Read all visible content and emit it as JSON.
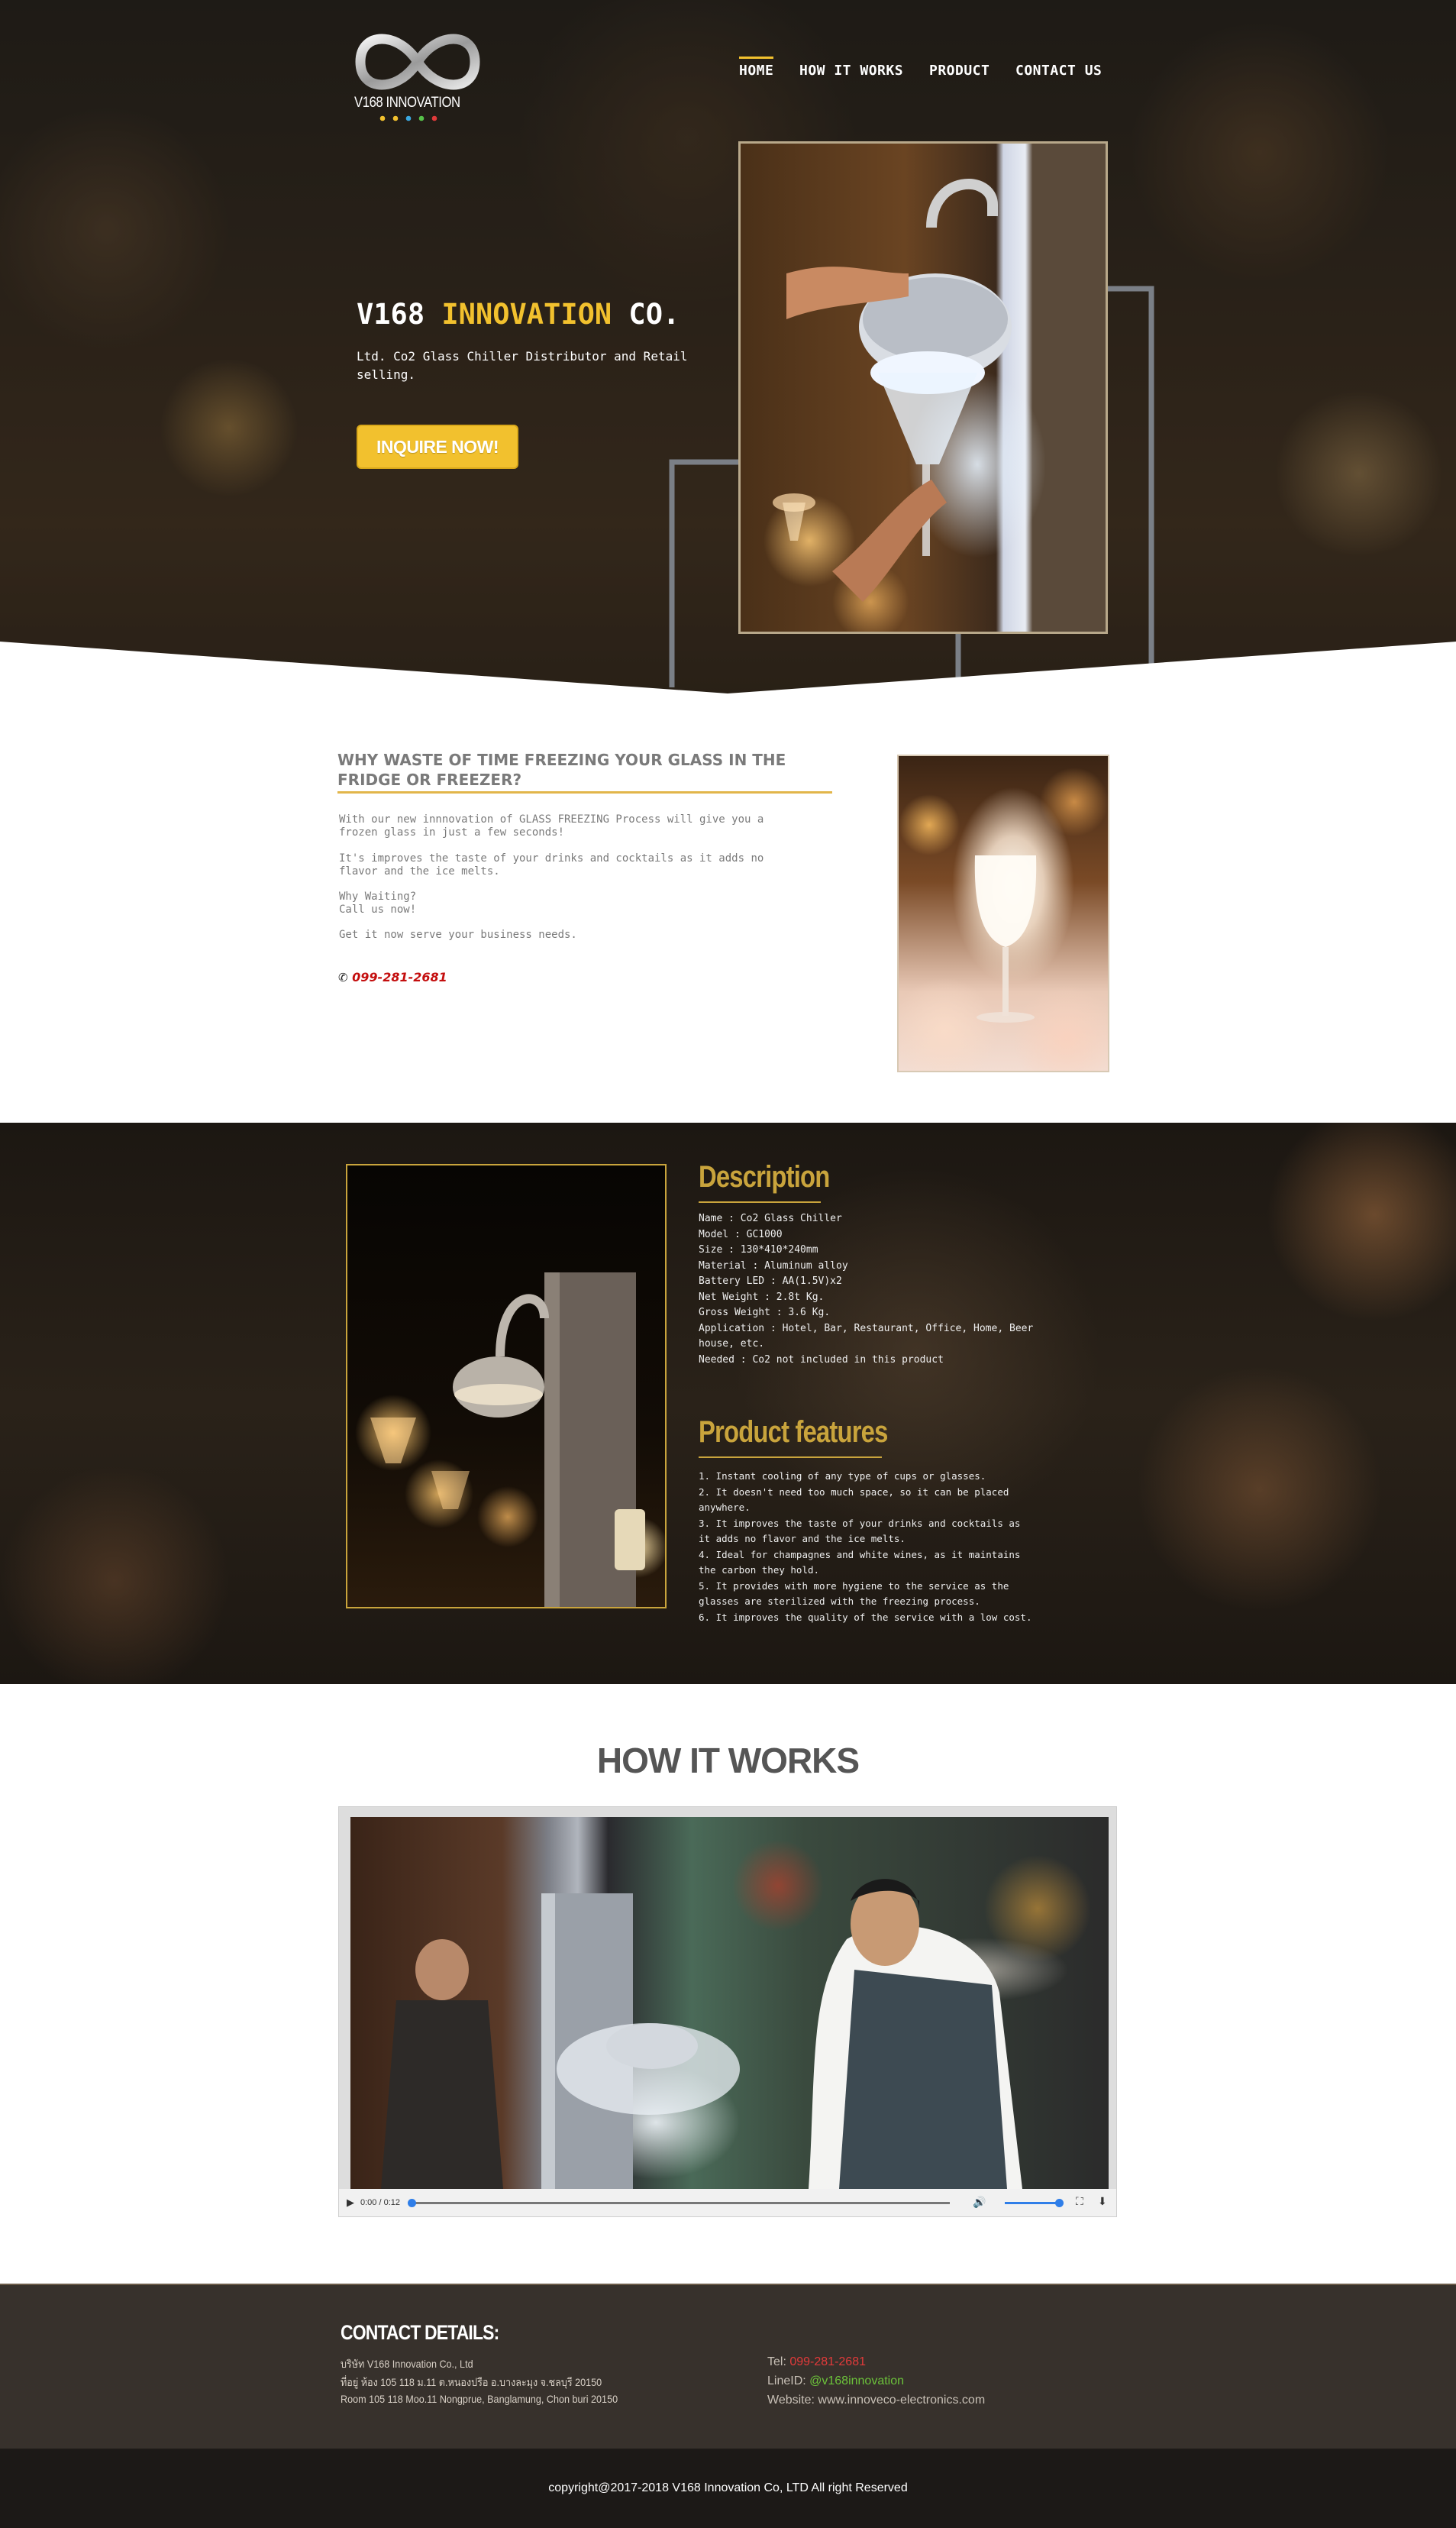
{
  "brand": {
    "logo_text": "V168 INNOVATION",
    "logo_dots": [
      "#f2c12e",
      "#f2c12e",
      "#3aa8e0",
      "#57c24a",
      "#e03a3a"
    ]
  },
  "nav": {
    "items": [
      "HOME",
      "HOW IT WORKS",
      "PRODUCT",
      "CONTACT US"
    ],
    "active": "HOME"
  },
  "hero": {
    "title_a": "V168 ",
    "title_b": "INNOVATION",
    "title_c": " CO.",
    "subtitle": "Ltd. Co2 Glass Chiller Distributor and Retail selling.",
    "cta": "INQUIRE NOW!"
  },
  "intro": {
    "heading": "WHY WASTE OF TIME FREEZING YOUR GLASS IN THE FRIDGE OR FREEZER?",
    "p1": "With our new innnovation of GLASS FREEZING Process will give you a frozen glass in just a few seconds!",
    "p2": "It's improves the taste of your drinks and cocktails as it adds no flavor and the ice melts.",
    "p3a": "Why Waiting?",
    "p3b": "Call us now!",
    "p4": "Get it now serve your business needs.",
    "phone": "099-281-2681"
  },
  "description": {
    "heading": "Description",
    "specs": [
      "Name : Co2 Glass Chiller",
      "Model : GC1000",
      "Size : 130*410*240mm",
      "Material : Aluminum alloy",
      "Battery LED : AA(1.5V)x2",
      "Net Weight : 2.8t Kg.",
      "Gross Weight : 3.6 Kg.",
      "Application : Hotel, Bar, Restaurant, Office, Home, Beer house, etc.",
      "Needed : Co2 not included in this product"
    ],
    "features_heading": "Product features",
    "features": [
      "1. Instant cooling of any type of cups or glasses.",
      "2. It doesn't need too much space, so it can be placed anywhere.",
      "3. It improves the taste of your drinks and cocktails as it adds no flavor and the ice melts.",
      "4. Ideal for champagnes and white wines, as it maintains the carbon they hold.",
      "5. It provides with more hygiene to the service as the glasses are sterilized with the freezing process.",
      "6. It improves the quality of the service with a low cost."
    ]
  },
  "how_it_works": {
    "heading": "HOW IT WORKS",
    "video_time": "0:00 / 0:12"
  },
  "contact": {
    "heading": "CONTACT DETAILS:",
    "line1": "บริษัท V168 Innovation Co., Ltd",
    "line2": "ที่อยู่ ห้อง 105 118 ม.11 ต.หนองปรือ อ.บางละมุง จ.ชลบุรี 20150",
    "line3": "Room 105 118 Moo.11 Nongprue, Banglamung, Chon buri 20150",
    "tel_label": "Tel: ",
    "tel": "099-281-2681",
    "line_label": "LineID: ",
    "line_id": "@v168innovation",
    "web_label": "Website: ",
    "website": "www.innoveco-electronics.com"
  },
  "footer": {
    "copyright": "copyright@2017-2018 V168 Innovation Co, LTD All right Reserved"
  },
  "colors": {
    "accent": "#f2c12e",
    "gold": "#c9a43c",
    "phone_red": "#c40e0e",
    "contact_bg": "#37312c",
    "footer_bg": "#1c1917"
  }
}
